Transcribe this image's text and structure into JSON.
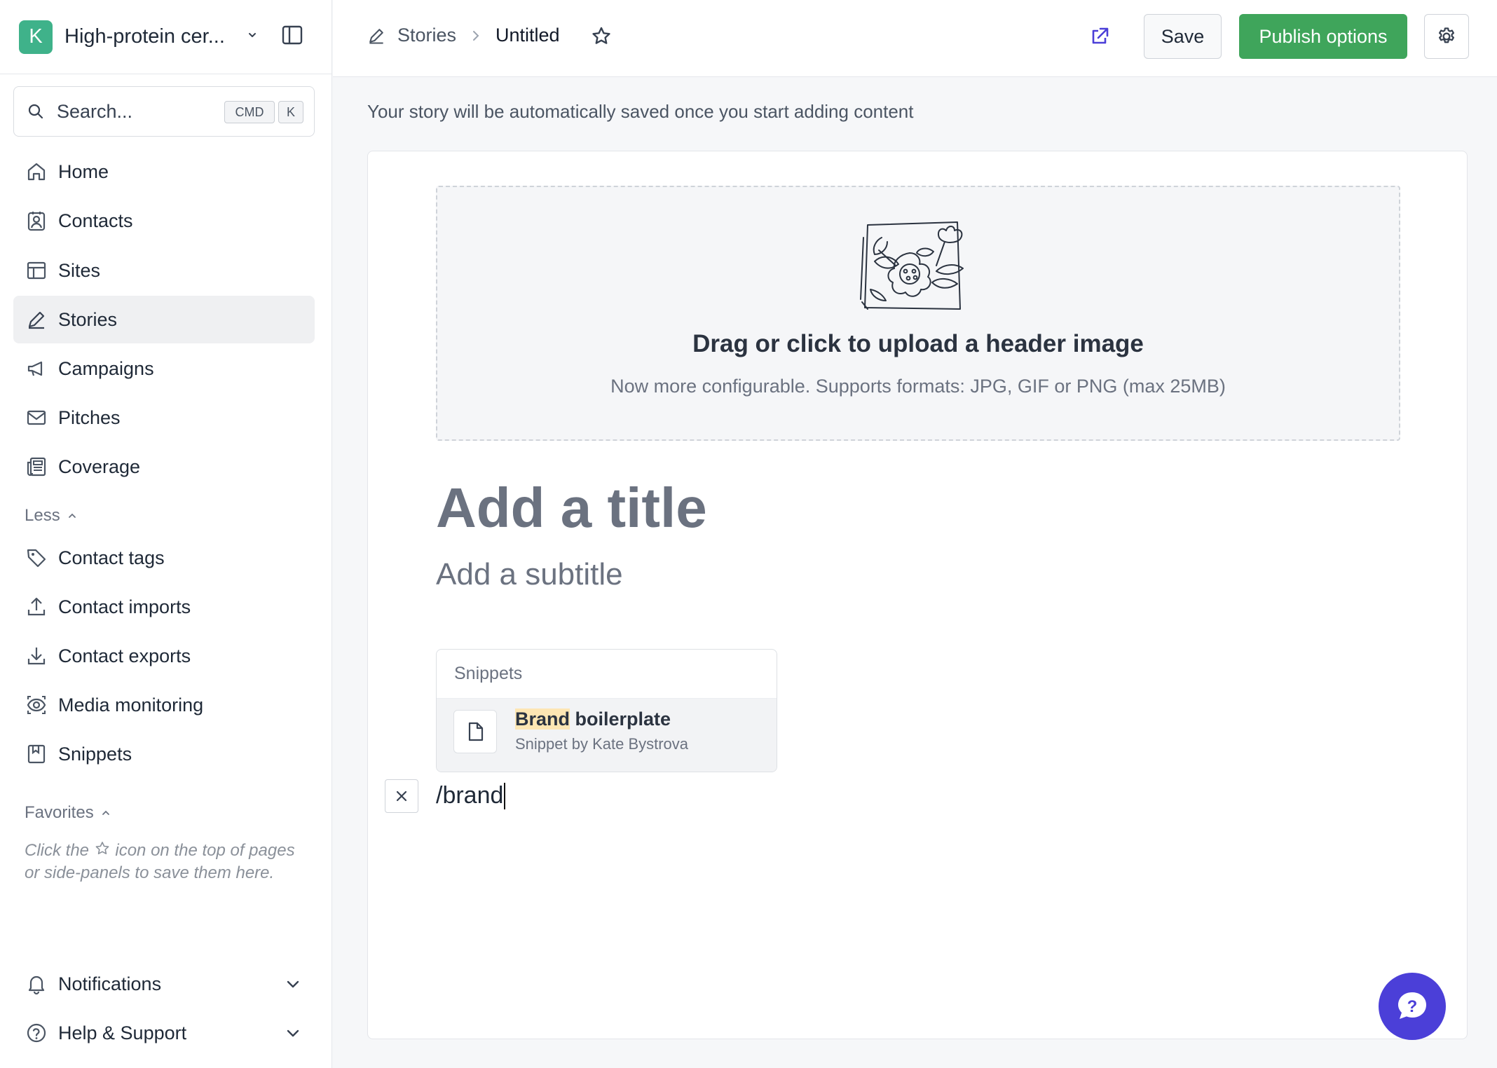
{
  "workspace": {
    "initial": "K",
    "name": "High-protein cer..."
  },
  "search": {
    "placeholder": "Search...",
    "shortcut_mod": "CMD",
    "shortcut_key": "K"
  },
  "sidebar": {
    "items": [
      {
        "label": "Home",
        "icon": "home-icon"
      },
      {
        "label": "Contacts",
        "icon": "contacts-icon"
      },
      {
        "label": "Sites",
        "icon": "sites-icon"
      },
      {
        "label": "Stories",
        "icon": "pencil-icon",
        "active": true
      },
      {
        "label": "Campaigns",
        "icon": "megaphone-icon"
      },
      {
        "label": "Pitches",
        "icon": "mail-icon"
      },
      {
        "label": "Coverage",
        "icon": "newspaper-icon"
      }
    ],
    "less_label": "Less",
    "more_items": [
      {
        "label": "Contact tags",
        "icon": "tag-icon"
      },
      {
        "label": "Contact imports",
        "icon": "upload-icon"
      },
      {
        "label": "Contact exports",
        "icon": "download-icon"
      },
      {
        "label": "Media monitoring",
        "icon": "eye-icon"
      },
      {
        "label": "Snippets",
        "icon": "bookmark-icon"
      }
    ],
    "favorites_label": "Favorites",
    "favorites_hint_before": "Click the",
    "favorites_hint_after": "icon on the top of pages or side-panels to save them here.",
    "bottom": [
      {
        "label": "Notifications",
        "icon": "bell-icon"
      },
      {
        "label": "Help & Support",
        "icon": "question-circle-icon"
      }
    ]
  },
  "topbar": {
    "breadcrumb_parent": "Stories",
    "breadcrumb_current": "Untitled",
    "save_label": "Save",
    "publish_label": "Publish options"
  },
  "editor": {
    "autosave_note": "Your story will be automatically saved once you start adding content",
    "upload_title": "Drag or click to upload a header image",
    "upload_subtitle": "Now more configurable. Supports formats: JPG, GIF or PNG (max 25MB)",
    "title_placeholder": "Add a title",
    "subtitle_placeholder": "Add a subtitle",
    "slash_command": "/brand"
  },
  "snippets_popup": {
    "header": "Snippets",
    "results": [
      {
        "match": "Brand",
        "rest": " boilerplate",
        "byline": "Snippet by Kate Bystrova"
      }
    ]
  },
  "colors": {
    "accent_green": "#3fa55b",
    "brand_purple": "#4b3fd8",
    "avatar_teal": "#3fb28a"
  },
  "help_fab": {
    "label": "?"
  }
}
